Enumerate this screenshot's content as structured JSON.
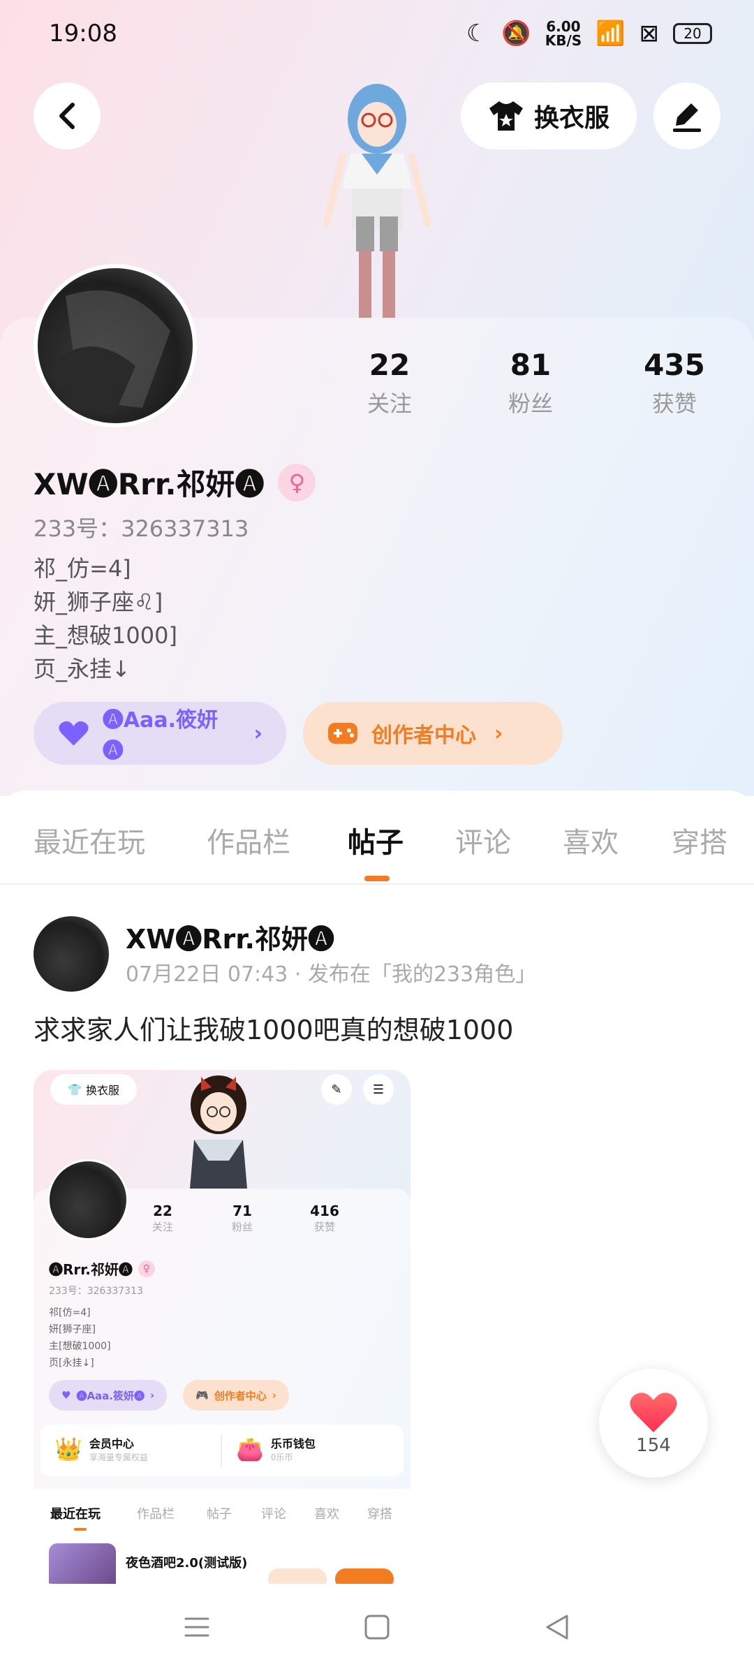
{
  "status": {
    "time": "19:08",
    "net_speed": "6.00",
    "net_unit": "KB/S",
    "battery": "20"
  },
  "header": {
    "outfit_label": "换衣服"
  },
  "profile": {
    "stats": [
      {
        "num": "22",
        "label": "关注"
      },
      {
        "num": "81",
        "label": "粉丝"
      },
      {
        "num": "435",
        "label": "获赞"
      }
    ],
    "name": "XW🅐Rrr.祁妍🅐",
    "gender_icon": "♀",
    "uid": "233号：326337313",
    "bio": [
      "祁_仿=4]",
      "妍_狮子座♌]",
      "主_想破1000]",
      "页_永挂↓"
    ],
    "badge_label": "🅐Aaa.筱妍🅐",
    "creator_label": "创作者中心"
  },
  "tabs": [
    "最近在玩",
    "作品栏",
    "帖子",
    "评论",
    "喜欢",
    "穿搭"
  ],
  "active_tab": "帖子",
  "post": {
    "user": "XW🅐Rrr.祁妍🅐",
    "meta": "07月22日 07:43 · 发布在「我的233角色」",
    "text": "求求家人们让我破1000吧真的想破1000",
    "likes": "154"
  },
  "shot": {
    "outfit_label": "换衣服",
    "stats": [
      {
        "num": "22",
        "label": "关注"
      },
      {
        "num": "71",
        "label": "粉丝"
      },
      {
        "num": "416",
        "label": "获赞"
      }
    ],
    "name": "🅐Rrr.祁妍🅐",
    "uid": "233号：326337313",
    "bio": [
      "祁[仿=4]",
      "妍[狮子座]",
      "主[想破1000]",
      "页[永挂↓]"
    ],
    "badge_label": "🅐Aaa.筱妍🅐",
    "creator_label": "创作者中心",
    "wallet": [
      {
        "title": "会员中心",
        "sub": "享海量专属权益"
      },
      {
        "title": "乐币钱包",
        "sub": "0乐币"
      }
    ],
    "tabs": [
      "最近在玩",
      "作品栏",
      "帖子",
      "评论",
      "喜欢",
      "穿搭"
    ],
    "row_title": "夜色酒吧2.0(测试版)"
  },
  "colors": {
    "accent": "#f47c20",
    "purple": "#7b61ff",
    "pink": "#f06292"
  }
}
